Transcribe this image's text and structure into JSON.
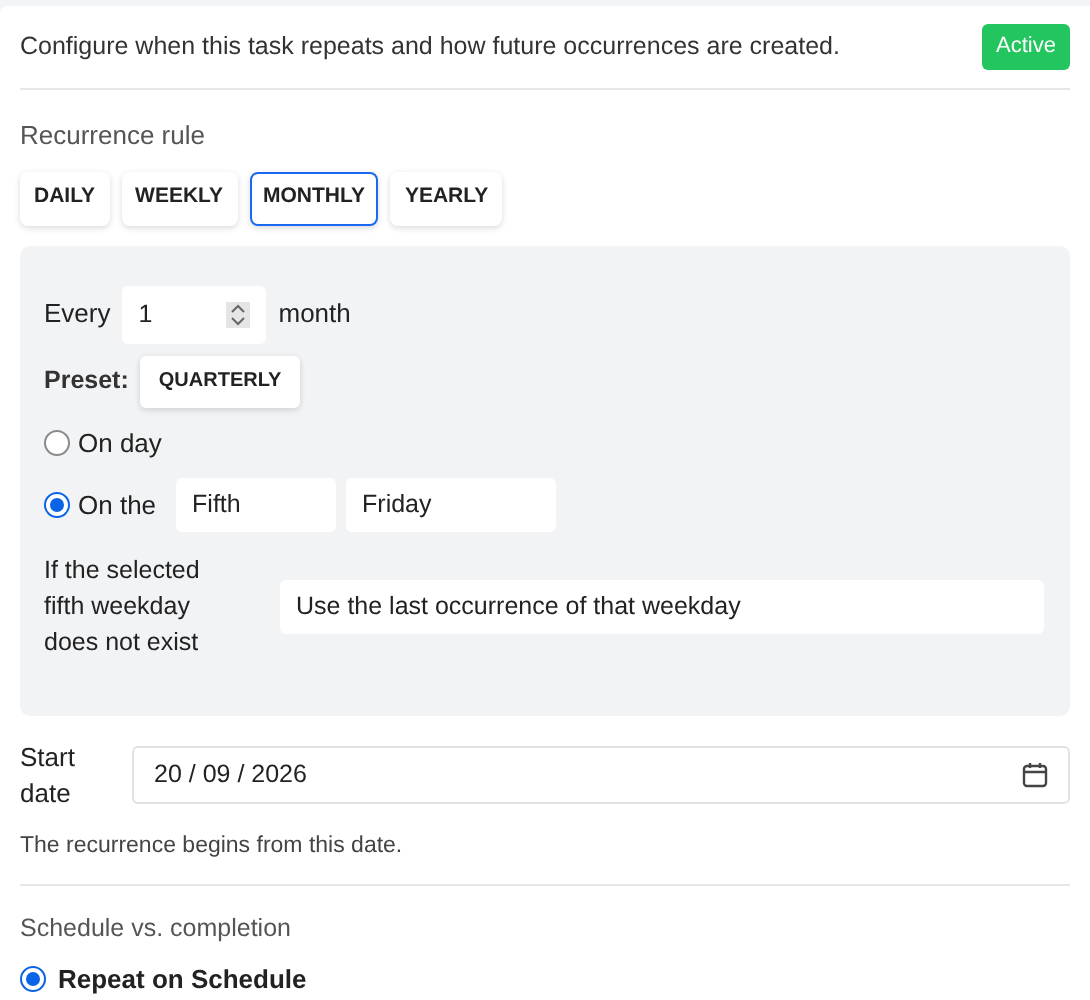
{
  "intro": "Configure when this task repeats and how future occurrences are created.",
  "status_badge": "Active",
  "recurrence_rule": {
    "label": "Recurrence rule",
    "frequencies": [
      {
        "label": "DAILY",
        "selected": false
      },
      {
        "label": "WEEKLY",
        "selected": false
      },
      {
        "label": "MONTHLY",
        "selected": true
      },
      {
        "label": "YEARLY",
        "selected": false
      }
    ]
  },
  "monthly": {
    "every_label": "Every",
    "interval": "1",
    "unit": "month",
    "preset_label": "Preset:",
    "preset_button": "QUARTERLY",
    "options": [
      {
        "label": "On day",
        "selected": false
      },
      {
        "label": "On the",
        "selected": true,
        "ordinal": "Fifth",
        "weekday": "Friday"
      }
    ],
    "fallback_label": "If the selected fifth weekday does not exist",
    "fallback_value": "Use the last occurrence of that weekday"
  },
  "start_date": {
    "label": "Start date",
    "value": "20 / 09 / 2026",
    "help": "The recurrence begins from this date."
  },
  "schedule": {
    "label": "Schedule vs. completion",
    "options": [
      {
        "label": "Repeat on Schedule",
        "selected": true
      }
    ]
  }
}
